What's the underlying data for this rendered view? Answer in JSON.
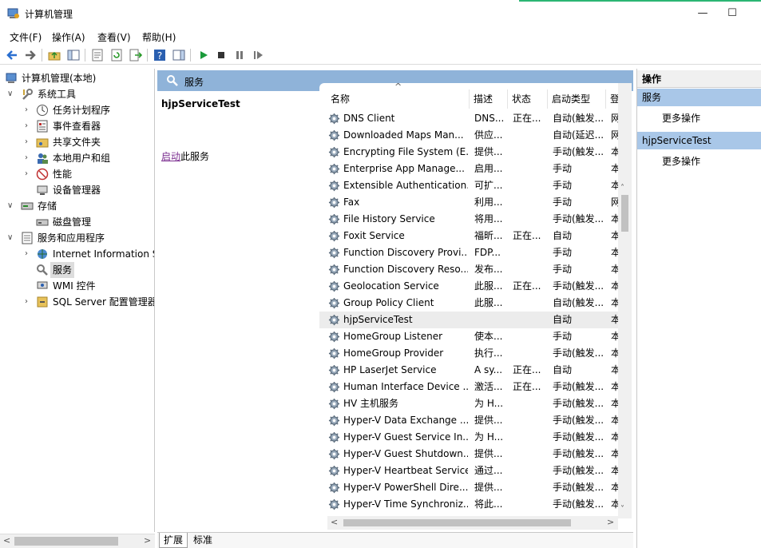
{
  "window": {
    "title": "计算机管理",
    "minimize": "—",
    "maximize": "☐"
  },
  "menu": [
    "文件(F)",
    "操作(A)",
    "查看(V)",
    "帮助(H)"
  ],
  "toolbar_icons": [
    "back-icon",
    "forward-icon",
    "up-folder-icon",
    "show-hide-tree-icon",
    "properties-icon",
    "refresh-icon",
    "export-icon",
    "help-icon",
    "show-hide-action-icon",
    "play-icon",
    "stop-icon",
    "pause-icon",
    "resume-icon"
  ],
  "tree": [
    {
      "label": "计算机管理(本地)",
      "level": 0,
      "expander": "",
      "icon": "computer-management-icon"
    },
    {
      "label": "系统工具",
      "level": 1,
      "expander": "∨",
      "icon": "system-tools-icon"
    },
    {
      "label": "任务计划程序",
      "level": 2,
      "expander": "›",
      "icon": "task-scheduler-icon"
    },
    {
      "label": "事件查看器",
      "level": 2,
      "expander": "›",
      "icon": "event-viewer-icon"
    },
    {
      "label": "共享文件夹",
      "level": 2,
      "expander": "›",
      "icon": "shared-folders-icon"
    },
    {
      "label": "本地用户和组",
      "level": 2,
      "expander": "›",
      "icon": "local-users-icon"
    },
    {
      "label": "性能",
      "level": 2,
      "expander": "›",
      "icon": "performance-icon"
    },
    {
      "label": "设备管理器",
      "level": 2,
      "expander": "",
      "icon": "device-manager-icon"
    },
    {
      "label": "存储",
      "level": 1,
      "expander": "∨",
      "icon": "storage-icon"
    },
    {
      "label": "磁盘管理",
      "level": 2,
      "expander": "",
      "icon": "disk-management-icon"
    },
    {
      "label": "服务和应用程序",
      "level": 1,
      "expander": "∨",
      "icon": "services-apps-icon"
    },
    {
      "label": "Internet Information S",
      "level": 2,
      "expander": "›",
      "icon": "iis-icon"
    },
    {
      "label": "服务",
      "level": 2,
      "expander": "",
      "icon": "services-icon",
      "selected": true
    },
    {
      "label": "WMI 控件",
      "level": 2,
      "expander": "",
      "icon": "wmi-icon"
    },
    {
      "label": "SQL Server 配置管理器",
      "level": 2,
      "expander": "›",
      "icon": "sql-config-icon"
    }
  ],
  "center": {
    "header": "服务",
    "selected_service": "hjpServiceTest",
    "start_link": "启动",
    "start_suffix": "此服务",
    "columns": [
      "名称",
      "描述",
      "状态",
      "启动类型",
      "登"
    ],
    "sort_indicator": "^"
  },
  "services": [
    {
      "name": "DNS Client",
      "desc": "DNS...",
      "status": "正在...",
      "startup": "自动(触发...",
      "logon": "网"
    },
    {
      "name": "Downloaded Maps Man...",
      "desc": "供应...",
      "status": "",
      "startup": "自动(延迟...",
      "logon": "网"
    },
    {
      "name": "Encrypting File System (E...",
      "desc": "提供...",
      "status": "",
      "startup": "手动(触发...",
      "logon": "本"
    },
    {
      "name": "Enterprise App Manage...",
      "desc": "启用...",
      "status": "",
      "startup": "手动",
      "logon": "本"
    },
    {
      "name": "Extensible Authentication...",
      "desc": "可扩...",
      "status": "",
      "startup": "手动",
      "logon": "本"
    },
    {
      "name": "Fax",
      "desc": "利用...",
      "status": "",
      "startup": "手动",
      "logon": "网"
    },
    {
      "name": "File History Service",
      "desc": "将用...",
      "status": "",
      "startup": "手动(触发...",
      "logon": "本"
    },
    {
      "name": "Foxit Service",
      "desc": "福昕...",
      "status": "正在...",
      "startup": "自动",
      "logon": "本"
    },
    {
      "name": "Function Discovery Provi...",
      "desc": "FDP...",
      "status": "",
      "startup": "手动",
      "logon": "本"
    },
    {
      "name": "Function Discovery Reso...",
      "desc": "发布...",
      "status": "",
      "startup": "手动",
      "logon": "本"
    },
    {
      "name": "Geolocation Service",
      "desc": "此服...",
      "status": "正在...",
      "startup": "手动(触发...",
      "logon": "本"
    },
    {
      "name": "Group Policy Client",
      "desc": "此服...",
      "status": "",
      "startup": "自动(触发...",
      "logon": "本"
    },
    {
      "name": "hjpServiceTest",
      "desc": "",
      "status": "",
      "startup": "自动",
      "logon": "本",
      "selected": true
    },
    {
      "name": "HomeGroup Listener",
      "desc": "使本...",
      "status": "",
      "startup": "手动",
      "logon": "本"
    },
    {
      "name": "HomeGroup Provider",
      "desc": "执行...",
      "status": "",
      "startup": "手动(触发...",
      "logon": "本"
    },
    {
      "name": "HP LaserJet Service",
      "desc": "A sy...",
      "status": "正在...",
      "startup": "自动",
      "logon": "本"
    },
    {
      "name": "Human Interface Device ...",
      "desc": "激活...",
      "status": "正在...",
      "startup": "手动(触发...",
      "logon": "本"
    },
    {
      "name": "HV 主机服务",
      "desc": "为 H...",
      "status": "",
      "startup": "手动(触发...",
      "logon": "本"
    },
    {
      "name": "Hyper-V Data Exchange ...",
      "desc": "提供...",
      "status": "",
      "startup": "手动(触发...",
      "logon": "本"
    },
    {
      "name": "Hyper-V Guest Service In...",
      "desc": "为 H...",
      "status": "",
      "startup": "手动(触发...",
      "logon": "本"
    },
    {
      "name": "Hyper-V Guest Shutdown...",
      "desc": "提供...",
      "status": "",
      "startup": "手动(触发...",
      "logon": "本"
    },
    {
      "name": "Hyper-V Heartbeat Service",
      "desc": "通过...",
      "status": "",
      "startup": "手动(触发...",
      "logon": "本"
    },
    {
      "name": "Hyper-V PowerShell Dire...",
      "desc": "提供...",
      "status": "",
      "startup": "手动(触发...",
      "logon": "本"
    },
    {
      "name": "Hyper-V Time Synchroniz...",
      "desc": "将此...",
      "status": "",
      "startup": "手动(触发...",
      "logon": "本"
    }
  ],
  "tabs": [
    "扩展",
    "标准"
  ],
  "actions": {
    "title": "操作",
    "sections": [
      {
        "header": "服务",
        "item": "更多操作"
      },
      {
        "header": "hjpServiceTest",
        "item": "更多操作"
      }
    ]
  },
  "scroll_arrows": {
    "up": "˄",
    "down": "˅",
    "left": "<",
    "right": ">"
  },
  "colors": {
    "pane_header": "#8fb3d9",
    "action_header": "#a9c7e8",
    "selected_row": "#ececec",
    "link": "#7a2c8f"
  }
}
